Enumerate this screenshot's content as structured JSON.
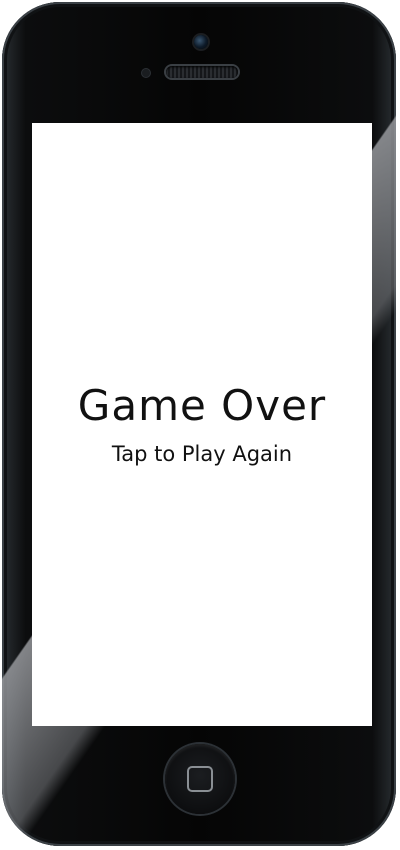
{
  "screen": {
    "title": "Game Over",
    "subtitle": "Tap to Play Again"
  },
  "device": {
    "body_color": "#050505",
    "screen_color": "#ffffff",
    "icons": [
      "camera-icon",
      "speaker-grille",
      "home-button-icon"
    ]
  }
}
